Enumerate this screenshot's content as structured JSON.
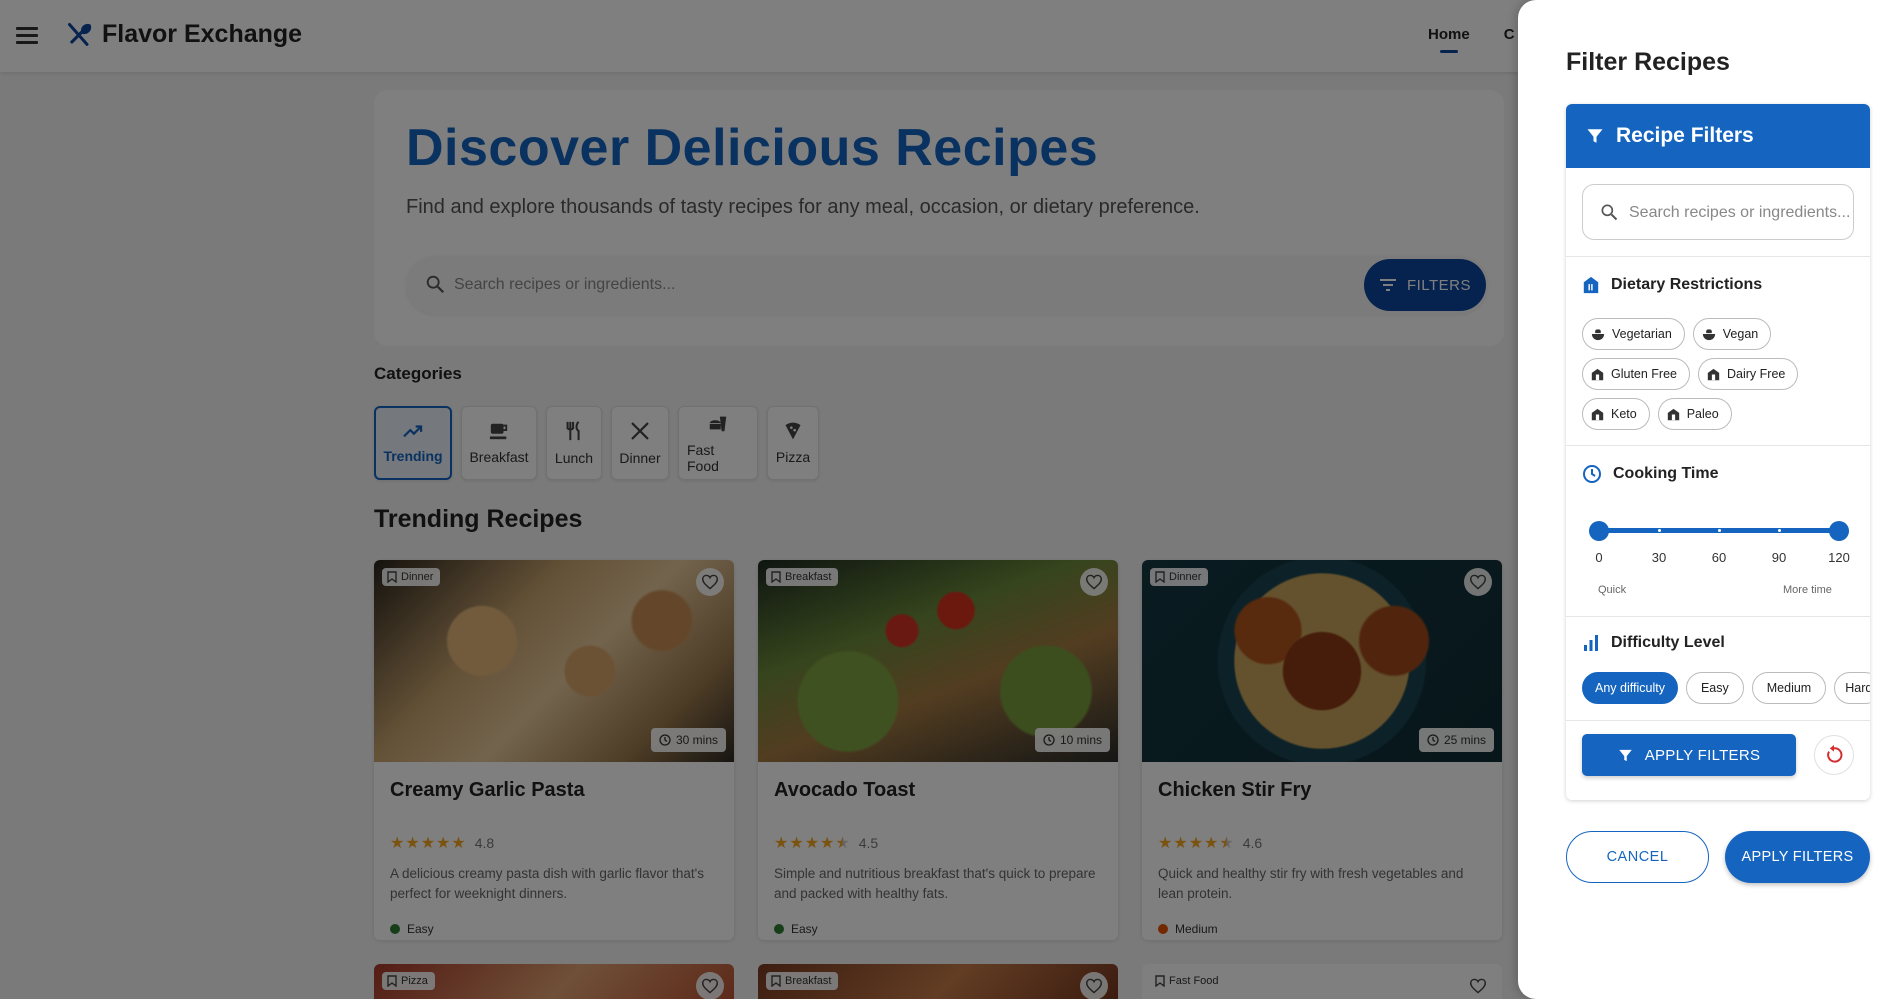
{
  "app": {
    "name": "Flavor Exchange"
  },
  "nav": {
    "home": "Home",
    "second": "C"
  },
  "hero": {
    "title": "Discover Delicious Recipes",
    "subtitle": "Find and explore thousands of tasty recipes for any meal, occasion, or dietary preference.",
    "search_placeholder": "Search recipes or ingredients...",
    "filters_label": "FILTERS"
  },
  "categories": {
    "label": "Categories",
    "items": [
      {
        "label": "Trending",
        "icon": "trending-up-icon",
        "active": true
      },
      {
        "label": "Breakfast",
        "icon": "coffee-icon"
      },
      {
        "label": "Lunch",
        "icon": "utensils-icon"
      },
      {
        "label": "Dinner",
        "icon": "dinner-icon"
      },
      {
        "label": "Fast Food",
        "icon": "fastfood-icon"
      },
      {
        "label": "Pizza",
        "icon": "pizza-icon"
      }
    ]
  },
  "trending": {
    "label": "Trending Recipes",
    "recipes": [
      {
        "category": "Dinner",
        "time": "30 mins",
        "title": "Creamy Garlic Pasta",
        "rating": "4.8",
        "stars": 5,
        "description": "A delicious creamy pasta dish with garlic flavor that's perfect for weeknight dinners.",
        "difficulty": "Easy"
      },
      {
        "category": "Breakfast",
        "time": "10 mins",
        "title": "Avocado Toast",
        "rating": "4.5",
        "stars": 4.5,
        "description": "Simple and nutritious breakfast that's quick to prepare and packed with healthy fats.",
        "difficulty": "Easy"
      },
      {
        "category": "Dinner",
        "time": "25 mins",
        "title": "Chicken Stir Fry",
        "rating": "4.6",
        "stars": 4.5,
        "description": "Quick and healthy stir fry with fresh vegetables and lean protein.",
        "difficulty": "Medium"
      }
    ],
    "next_row": [
      {
        "category": "Pizza"
      },
      {
        "category": "Breakfast"
      },
      {
        "category": "Fast Food"
      }
    ]
  },
  "colors": {
    "primary": "#1565c0",
    "easy": "#2e7d32",
    "medium": "#e65100",
    "star": "#f5a623"
  },
  "drawer": {
    "title": "Filter Recipes",
    "panel_title": "Recipe Filters",
    "search_placeholder": "Search recipes or ingredients...",
    "dietary": {
      "label": "Dietary Restrictions",
      "options": [
        "Vegetarian",
        "Vegan",
        "Gluten Free",
        "Dairy Free",
        "Keto",
        "Paleo"
      ]
    },
    "cooking_time": {
      "label": "Cooking Time",
      "ticks": [
        "0",
        "30",
        "60",
        "90",
        "120"
      ],
      "min_label": "Quick",
      "max_label": "More time",
      "range": [
        0,
        120
      ]
    },
    "difficulty": {
      "label": "Difficulty Level",
      "options": [
        "Any difficulty",
        "Easy",
        "Medium",
        "Hard"
      ],
      "selected": "Any difficulty"
    },
    "apply_small": "APPLY FILTERS",
    "cancel": "CANCEL",
    "apply": "APPLY FILTERS"
  }
}
